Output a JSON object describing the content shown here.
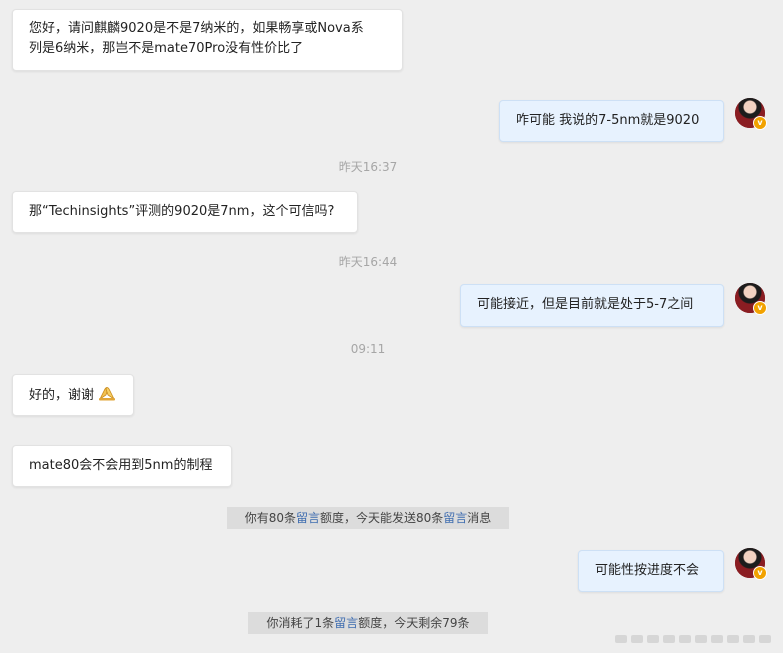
{
  "messages": {
    "m1": "您好，请问麒麟9020是不是7纳米的，如果畅享或Nova系",
    "m1b": "列是6纳米，那岂不是mate70Pro没有性价比了",
    "r1": "咋可能  我说的7-5nm就是9020",
    "ts1": "昨天16:37",
    "m2": "那“Techinsights”评测的9020是7nm，这个可信吗?",
    "ts2": "昨天16:44",
    "r2": "可能接近，但是目前就是处于5-7之间",
    "ts3": "09:11",
    "m3": "好的，谢谢",
    "m4": "mate80会不会用到5nm的制程",
    "r3": "可能性按进度不会"
  },
  "notices": {
    "n1_a": "你有80条",
    "n1_link1": "留言",
    "n1_b": "额度，今天能发送80条",
    "n1_link2": "留言",
    "n1_c": "消息",
    "n2_a": "你消耗了1条",
    "n2_link": "留言",
    "n2_b": "额度，今天剩余79条"
  },
  "icons": {
    "avatar": "user-avatar-icon",
    "verified": "verified-badge-icon",
    "emoji": "folded-hands-emoji"
  },
  "colors": {
    "background": "#eeeeee",
    "incoming_bubble": "#ffffff",
    "outgoing_bubble": "#e7f2fe",
    "link": "#3f6db0",
    "notice_bg": "#dcdcdc"
  }
}
